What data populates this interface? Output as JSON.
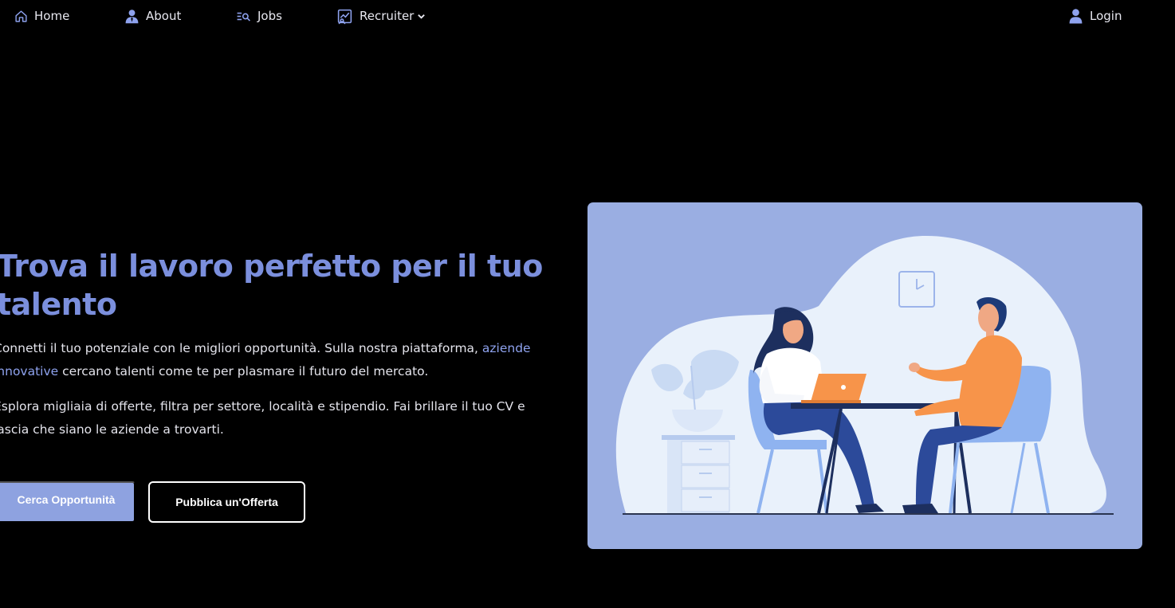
{
  "nav": {
    "home": {
      "label": "Home",
      "icon": "home-icon"
    },
    "about": {
      "label": "About",
      "icon": "user-tie-icon"
    },
    "jobs": {
      "label": "Jobs",
      "icon": "list-search-icon"
    },
    "recruiter": {
      "label": "Recruiter",
      "icon": "chart-board-icon"
    },
    "login": {
      "label": "Login",
      "icon": "user-icon"
    }
  },
  "hero": {
    "title": "Trova il lavoro perfetto per il tuo talento",
    "p1_before": "Connetti il tuo potenziale con le migliori opportunità. Sulla nostra piattaforma, ",
    "p1_accent": "aziende innovative",
    "p1_after": " cercano talenti come te per plasmare il futuro del mercato.",
    "p2": "Esplora migliaia di offerte, filtra per settore, località e stipendio. Fai brillare il tuo CV e lascia che siano le aziende a trovarti.",
    "cta_primary": "Cerca Opportunità",
    "cta_secondary": "Pubblica un'Offerta"
  },
  "colors": {
    "background": "#000000",
    "accent": "#7b8fdd",
    "primary_button": "#8ea2e0",
    "illustration_bg": "#9aaee2"
  }
}
